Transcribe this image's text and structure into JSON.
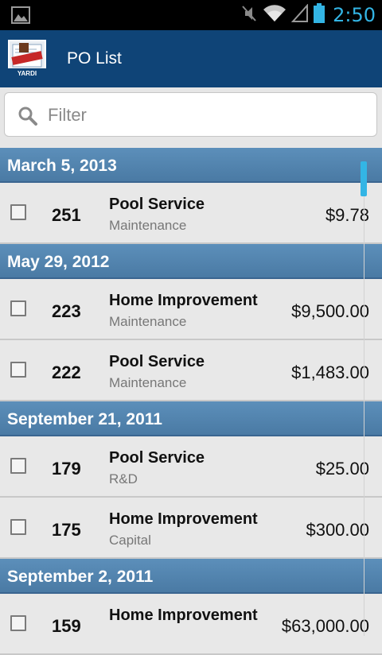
{
  "status": {
    "time": "2:50"
  },
  "app": {
    "title": "PO List"
  },
  "filter": {
    "placeholder": "Filter"
  },
  "sections": [
    {
      "date": "March 5, 2013",
      "items": [
        {
          "number": "251",
          "title": "Pool Service",
          "category": "Maintenance",
          "amount": "$9.78"
        }
      ]
    },
    {
      "date": "May 29, 2012",
      "items": [
        {
          "number": "223",
          "title": "Home Improvement",
          "category": "Maintenance",
          "amount": "$9,500.00"
        },
        {
          "number": "222",
          "title": "Pool Service",
          "category": "Maintenance",
          "amount": "$1,483.00"
        }
      ]
    },
    {
      "date": "September 21, 2011",
      "items": [
        {
          "number": "179",
          "title": "Pool Service",
          "category": "R&D",
          "amount": "$25.00"
        },
        {
          "number": "175",
          "title": "Home Improvement",
          "category": "Capital",
          "amount": "$300.00"
        }
      ]
    },
    {
      "date": "September 2, 2011",
      "items": [
        {
          "number": "159",
          "title": "Home Improvement",
          "category": "",
          "amount": "$63,000.00"
        }
      ]
    }
  ],
  "colors": {
    "appbar": "#0f4477",
    "section_header": "#4f80ab",
    "status_accent": "#33b5e5"
  },
  "icons": {
    "status_left": "picture-icon",
    "status_right": [
      "mute-icon",
      "wifi-icon",
      "signal-icon",
      "battery-icon"
    ],
    "filter": "search-icon"
  }
}
